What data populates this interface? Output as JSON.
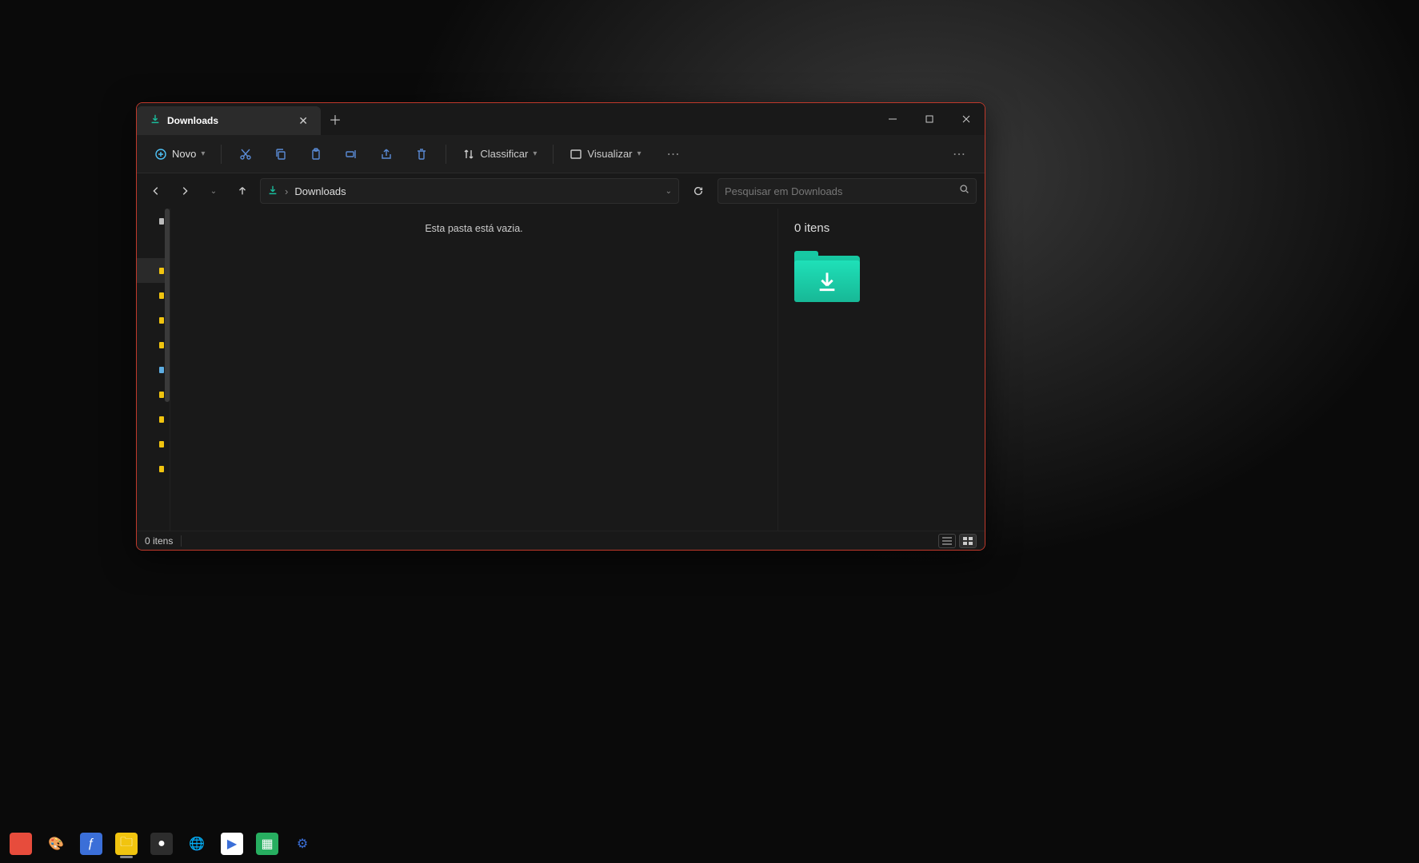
{
  "window": {
    "tab_title": "Downloads",
    "toolbar": {
      "new_label": "Novo",
      "sort_label": "Classificar",
      "view_label": "Visualizar"
    },
    "address": {
      "current": "Downloads"
    },
    "search": {
      "placeholder": "Pesquisar em Downloads"
    },
    "main": {
      "empty_message": "Esta pasta está vazia."
    },
    "details": {
      "header": "0 itens"
    },
    "status": {
      "item_count": "0 itens"
    }
  },
  "taskbar": {
    "apps": [
      {
        "name": "app-red",
        "bg": "#e74c3c",
        "glyph": ""
      },
      {
        "name": "paint",
        "bg": "transparent",
        "glyph": "🎨"
      },
      {
        "name": "fedora",
        "bg": "#3b6fd8",
        "glyph": "ƒ"
      },
      {
        "name": "file-explorer",
        "bg": "#f1c40f",
        "glyph": "🗀",
        "active": true
      },
      {
        "name": "resolve",
        "bg": "#2d2d2d",
        "glyph": "●"
      },
      {
        "name": "edge",
        "bg": "transparent",
        "glyph": "🌐"
      },
      {
        "name": "media",
        "bg": "#fff",
        "glyph": "▶"
      },
      {
        "name": "calc",
        "bg": "#27ae60",
        "glyph": "▦"
      },
      {
        "name": "settings",
        "bg": "transparent",
        "glyph": "⚙"
      }
    ]
  }
}
